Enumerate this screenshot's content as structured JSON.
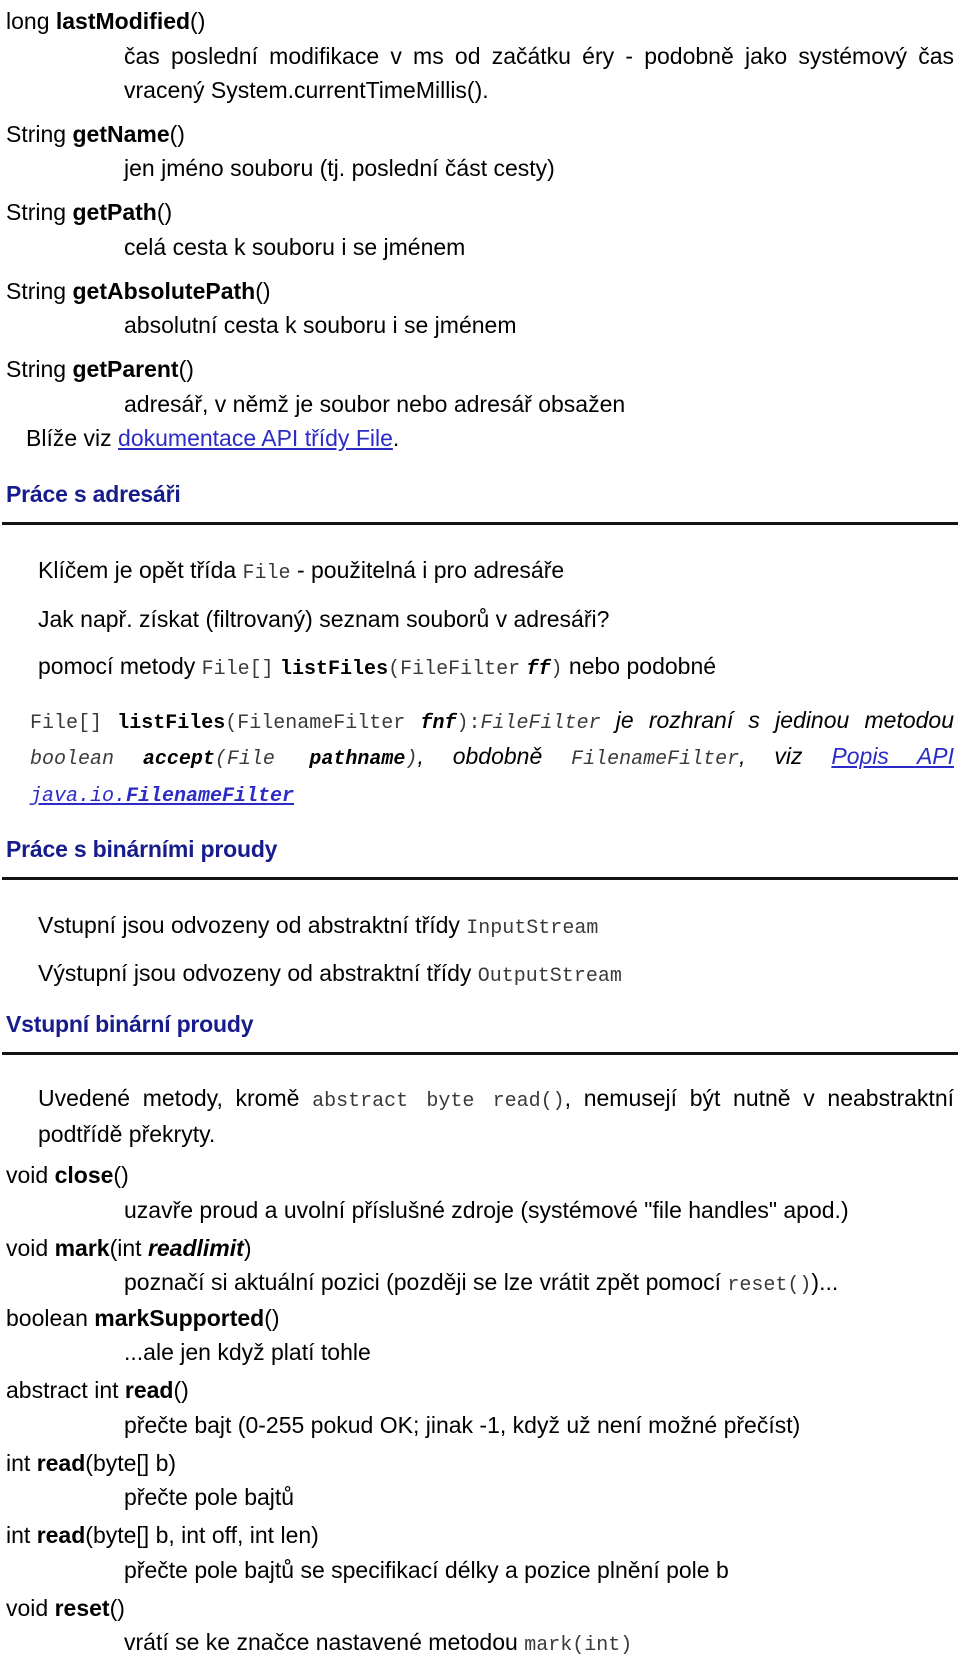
{
  "colors": {
    "heading": "#161c8c",
    "link": "#2b2bc8",
    "code": "#3a3a3a",
    "rule": "#141414",
    "text": "#000000",
    "background": "#ffffff"
  },
  "file_methods": {
    "lastModified": {
      "return_type": "long",
      "name": "lastModified",
      "parens": "()",
      "description": "čas poslední modifikace v ms od začátku éry - podobně jako systémový čas vracený System.currentTimeMillis()."
    },
    "getName": {
      "return_type": "String",
      "name": "getName",
      "parens": "()",
      "description": "jen jméno souboru (tj. poslední část cesty)"
    },
    "getPath": {
      "return_type": "String",
      "name": "getPath",
      "parens": "()",
      "description": "celá cesta k souboru i se jménem"
    },
    "getAbsolutePath": {
      "return_type": "String",
      "name": "getAbsolutePath",
      "parens": "()",
      "description": "absolutní cesta k souboru i se jménem"
    },
    "getParent": {
      "return_type": "String",
      "name": "getParent",
      "parens": "()",
      "description": "adresář, v němž je soubor nebo adresář obsažen"
    }
  },
  "see_also": {
    "prefix": "Blíže viz ",
    "link_text": "dokumentace API třídy File",
    "suffix": "."
  },
  "section_directories": {
    "heading": "Práce s adresáři",
    "line1_before_code": "Klíčem je opět třída ",
    "line1_code": "File",
    "line1_after_code": " - použitelná i pro adresáře",
    "line2": "Jak např. získat (filtrovaný) seznam souborů v adresáři?",
    "line3_prefix": "pomocí metody ",
    "line3_code_type": "File[]",
    "line3_code_method": "listFiles",
    "line3_code_open": "(",
    "line3_code_param_type": "FileFilter",
    "line3_code_param_name": "ff",
    "line3_code_close": ")",
    "line3_suffix": " nebo podobné",
    "para4": {
      "code_type": "File[]",
      "code_method": "listFiles",
      "code_open": "(",
      "code_param_type": "FilenameFilter",
      "code_param_name": "fnf",
      "code_close": ")",
      "colon": ":",
      "code_iface": "FileFilter",
      "text1": " je rozhraní s jedinou metodou ",
      "code_bool": "boolean",
      "code_accept": "accept",
      "code_accept_open": "(File ",
      "code_accept_param": "pathname",
      "code_accept_close": ")",
      "text2": ", obdobně ",
      "code_fnf": "FilenameFilter",
      "text3": ", viz ",
      "link_text_part1": "Popis API ",
      "link_code_pkg": "java.io.",
      "link_code_iface": "FilenameFilter"
    }
  },
  "section_binary": {
    "heading": "Práce s binárními proudy",
    "line1_prefix": "Vstupní jsou odvozeny od abstraktní třídy ",
    "line1_code": "InputStream",
    "line2_prefix": "Výstupní jsou odvozeny od abstraktní třídy ",
    "line2_code": "OutputStream"
  },
  "section_input_binary": {
    "heading": "Vstupní binární proudy",
    "intro_part1": "Uvedené metody, kromě ",
    "intro_code": "abstract byte read()",
    "intro_part2": ", nemusejí být nutně v neabstraktní podtřídě překryty.",
    "methods": [
      {
        "return_type": "void",
        "name": "close",
        "parens": "()",
        "description": "uzavře proud a uvolní příslušné zdroje (systémové \"file handles\" apod.)"
      },
      {
        "return_type": "void",
        "name": "mark",
        "parens_open": "(",
        "param_type": "int ",
        "param_name": "readlimit",
        "parens_close": ")",
        "description_prefix": "poznačí si aktuální pozici (později se lze vrátit zpět pomocí ",
        "description_code": "reset()",
        "description_suffix": ")..."
      },
      {
        "return_type": "boolean",
        "name": "markSupported",
        "parens": "()",
        "description": "...ale jen když platí tohle"
      },
      {
        "return_type": "abstract int",
        "name": "read",
        "parens": "()",
        "description": "přečte bajt (0-255 pokud OK; jinak -1, když už není možné přečíst)"
      },
      {
        "return_type": "int",
        "name": "read",
        "parens": "(byte[] b)",
        "description": "přečte pole bajtů"
      },
      {
        "return_type": "int",
        "name": "read",
        "parens": "(byte[] b, int off, int len)",
        "description": "přečte pole bajtů se specifikací délky a pozice plnění pole b"
      },
      {
        "return_type": "void",
        "name": "reset",
        "parens": "()",
        "description_prefix": "vrátí se ke značce nastavené metodou ",
        "description_code": "mark(int)"
      }
    ]
  }
}
